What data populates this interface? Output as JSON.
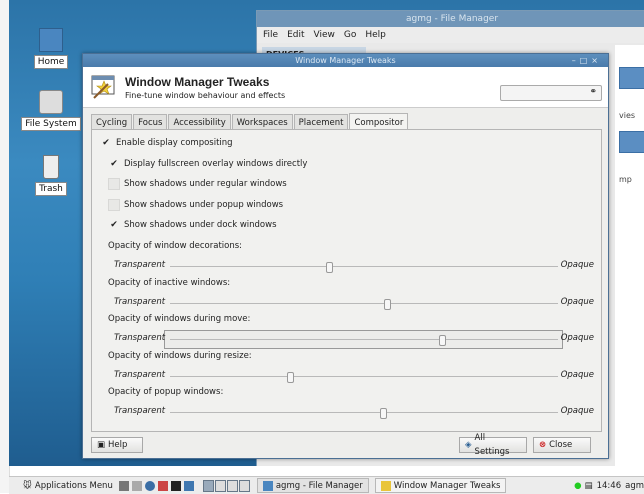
{
  "desktop": {
    "icons": [
      {
        "label": "Home"
      },
      {
        "label": "File System"
      },
      {
        "label": "Trash"
      }
    ]
  },
  "file_manager": {
    "title": "agmg - File Manager",
    "menu": [
      "File",
      "Edit",
      "View",
      "Go",
      "Help"
    ],
    "devices_label": "DEVICES",
    "path": "agmg",
    "right_labels": [
      "vies",
      "mp"
    ]
  },
  "dialog": {
    "window_title": "Window Manager Tweaks",
    "title": "Window Manager Tweaks",
    "subtitle": "Fine-tune window behaviour and effects",
    "tabs": [
      "Cycling",
      "Focus",
      "Accessibility",
      "Workspaces",
      "Placement",
      "Compositor"
    ],
    "active_tab": "Compositor",
    "options": [
      {
        "label": "Enable display compositing",
        "checked": true
      },
      {
        "label": "Display fullscreen overlay windows directly",
        "checked": true
      },
      {
        "label": "Show shadows under regular windows",
        "checked": false
      },
      {
        "label": "Show shadows under popup windows",
        "checked": false
      },
      {
        "label": "Show shadows under dock windows",
        "checked": true
      }
    ],
    "sliders": [
      {
        "label": "Opacity of window decorations:",
        "min_label": "Transparent",
        "max_label": "Opaque",
        "value": 0.41
      },
      {
        "label": "Opacity of inactive windows:",
        "min_label": "Transparent",
        "max_label": "Opaque",
        "value": 0.56
      },
      {
        "label": "Opacity of windows during move:",
        "min_label": "Transparent",
        "max_label": "Opaque",
        "value": 0.7
      },
      {
        "label": "Opacity of windows during resize:",
        "min_label": "Transparent",
        "max_label": "Opaque",
        "value": 0.31
      },
      {
        "label": "Opacity of popup windows:",
        "min_label": "Transparent",
        "max_label": "Opaque",
        "value": 0.55
      }
    ],
    "help_label": "Help",
    "all_settings_label": "All Settings",
    "close_label": "Close"
  },
  "taskbar": {
    "apps_menu": "Applications Menu",
    "tasks": [
      "agmg - File Manager",
      "Window Manager Tweaks"
    ],
    "clock": "14:46",
    "user": "agm"
  },
  "colors": {
    "desktop": "#2f7fb6",
    "title_active": "#4a7bab",
    "close_red": "#cc2222"
  }
}
